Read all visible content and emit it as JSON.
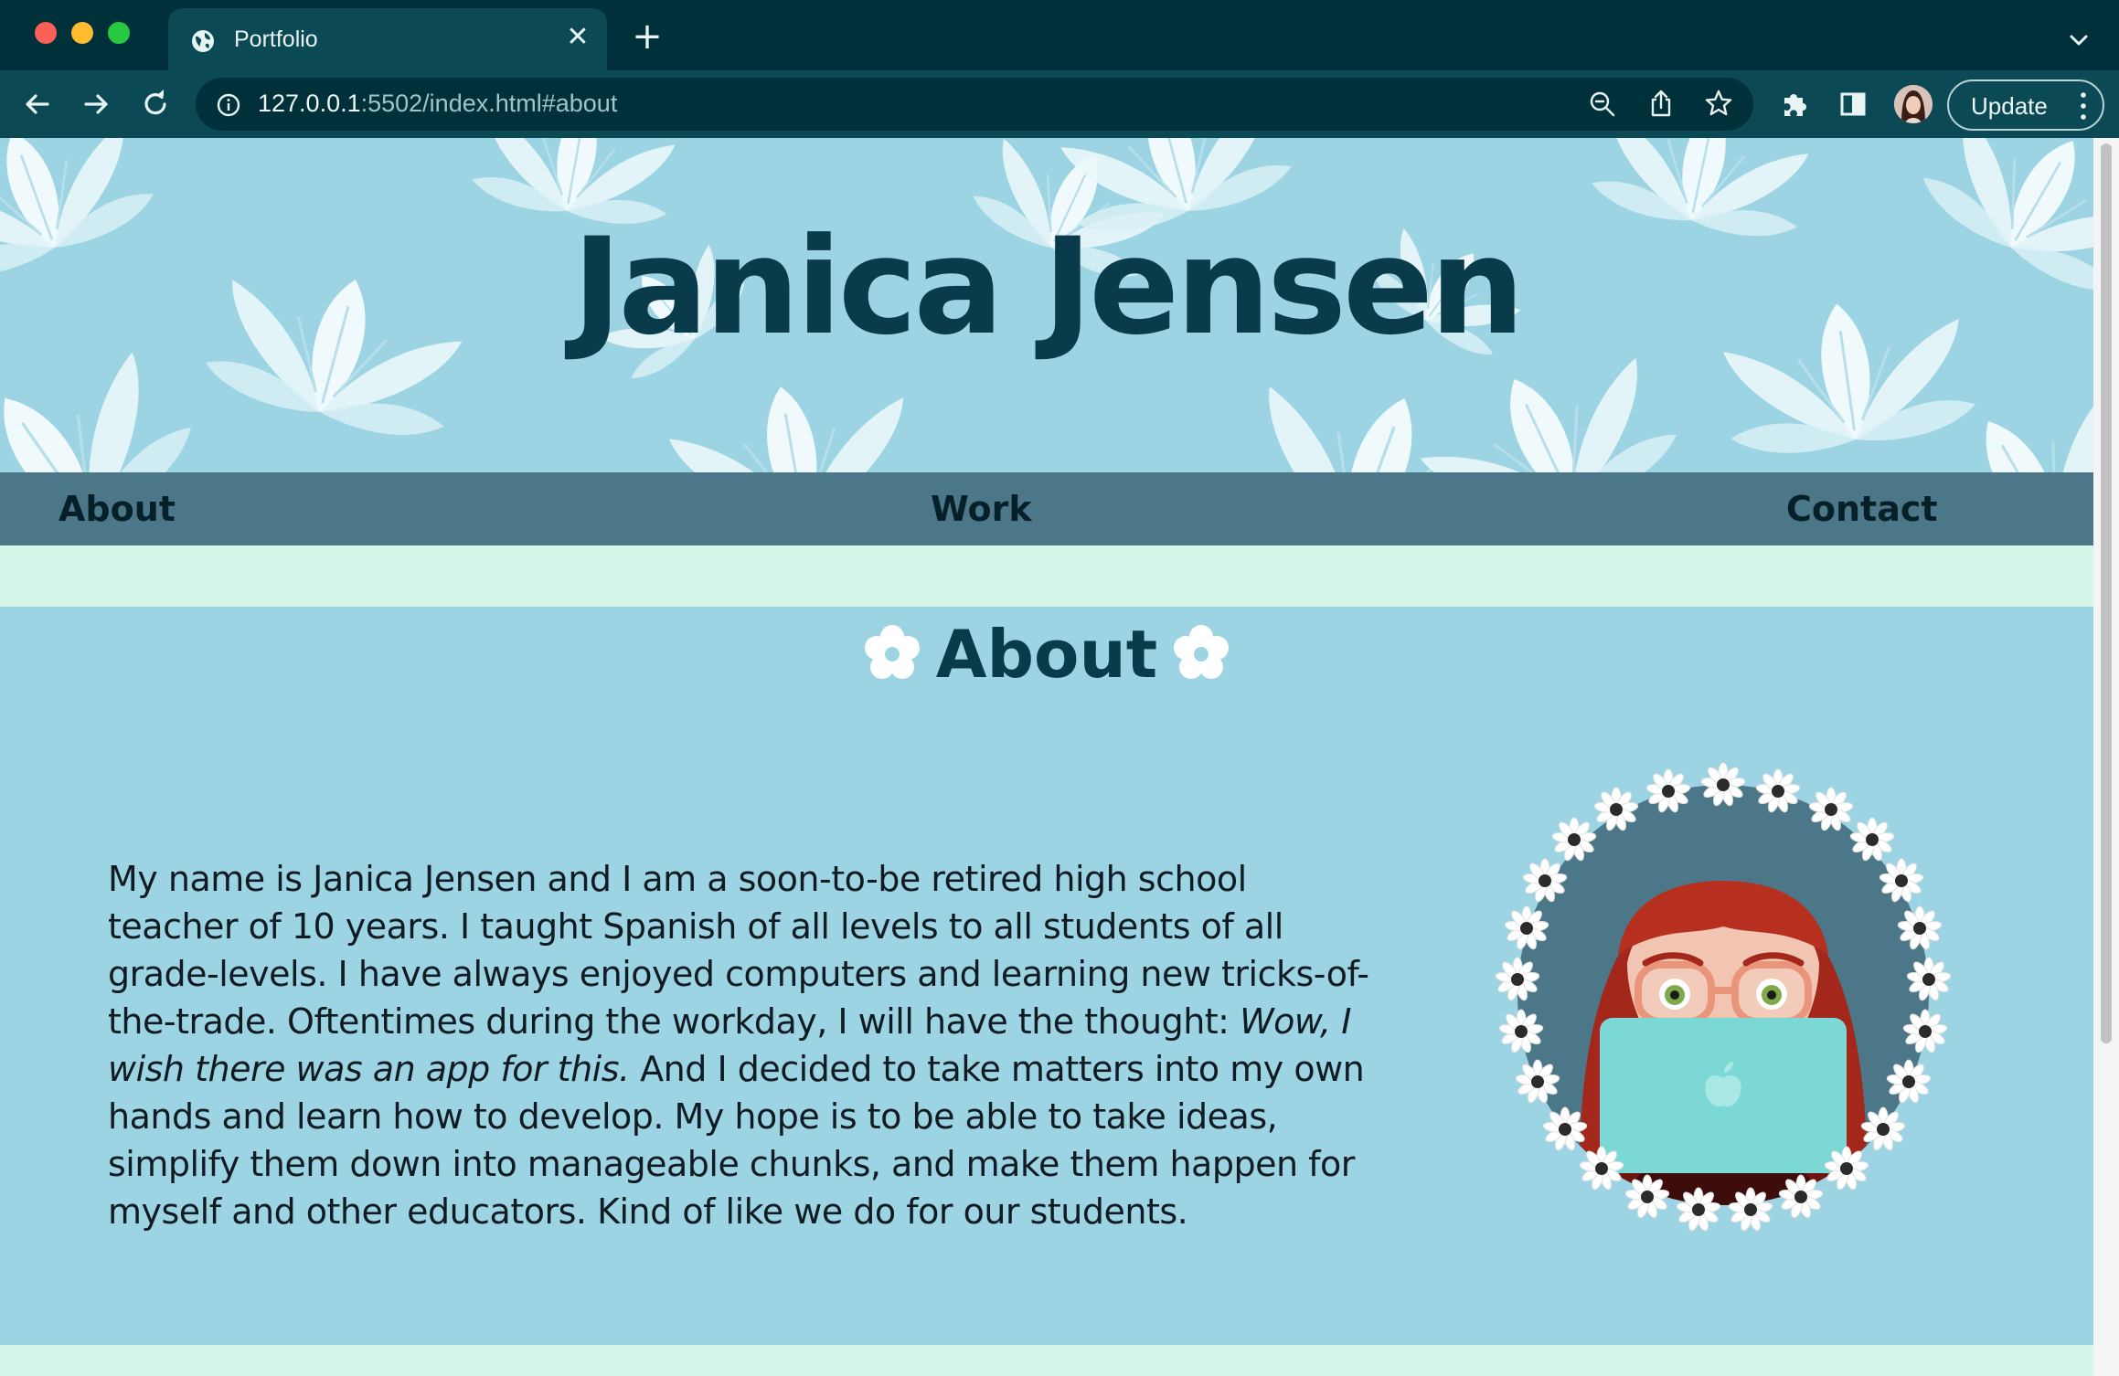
{
  "browser": {
    "tab_title": "Portfolio",
    "url_host": "127.0.0.1",
    "url_rest": ":5502/index.html#about",
    "update_label": "Update"
  },
  "hero": {
    "title": "Janica Jensen"
  },
  "nav": {
    "items": [
      {
        "label": "About"
      },
      {
        "label": "Work"
      },
      {
        "label": "Contact"
      }
    ]
  },
  "about": {
    "heading": "About",
    "text_part1": "My name is Janica Jensen and I am a soon-to-be retired high school teacher of 10 years. I taught Spanish of all levels to all students of all grade-levels. I have always enjoyed computers and learning new tricks-of-the-trade. Oftentimes during the workday, I will have the thought: ",
    "text_italic": "Wow, I wish there was an app for this.",
    "text_part2": " And I decided to take matters into my own hands and learn how to develop. My hope is to be able to take ideas, simplify them down into manageable chunks, and make them happen for myself and other educators. Kind of like we do for our students."
  },
  "colors": {
    "chrome_dark": "#00313a",
    "chrome_tab": "#0b4a55",
    "hero_bg": "#9dd4e3",
    "nav_bg": "#4c7788",
    "mint": "#d6f6ea",
    "title_text": "#0a3b4a"
  },
  "icons": {
    "tab": "globe-icon",
    "toolbar": [
      "back-arrow-icon",
      "forward-arrow-icon",
      "reload-icon",
      "info-icon",
      "zoom-out-icon",
      "share-icon",
      "star-icon",
      "puzzle-icon",
      "side-panel-icon",
      "kebab-menu-icon"
    ]
  }
}
